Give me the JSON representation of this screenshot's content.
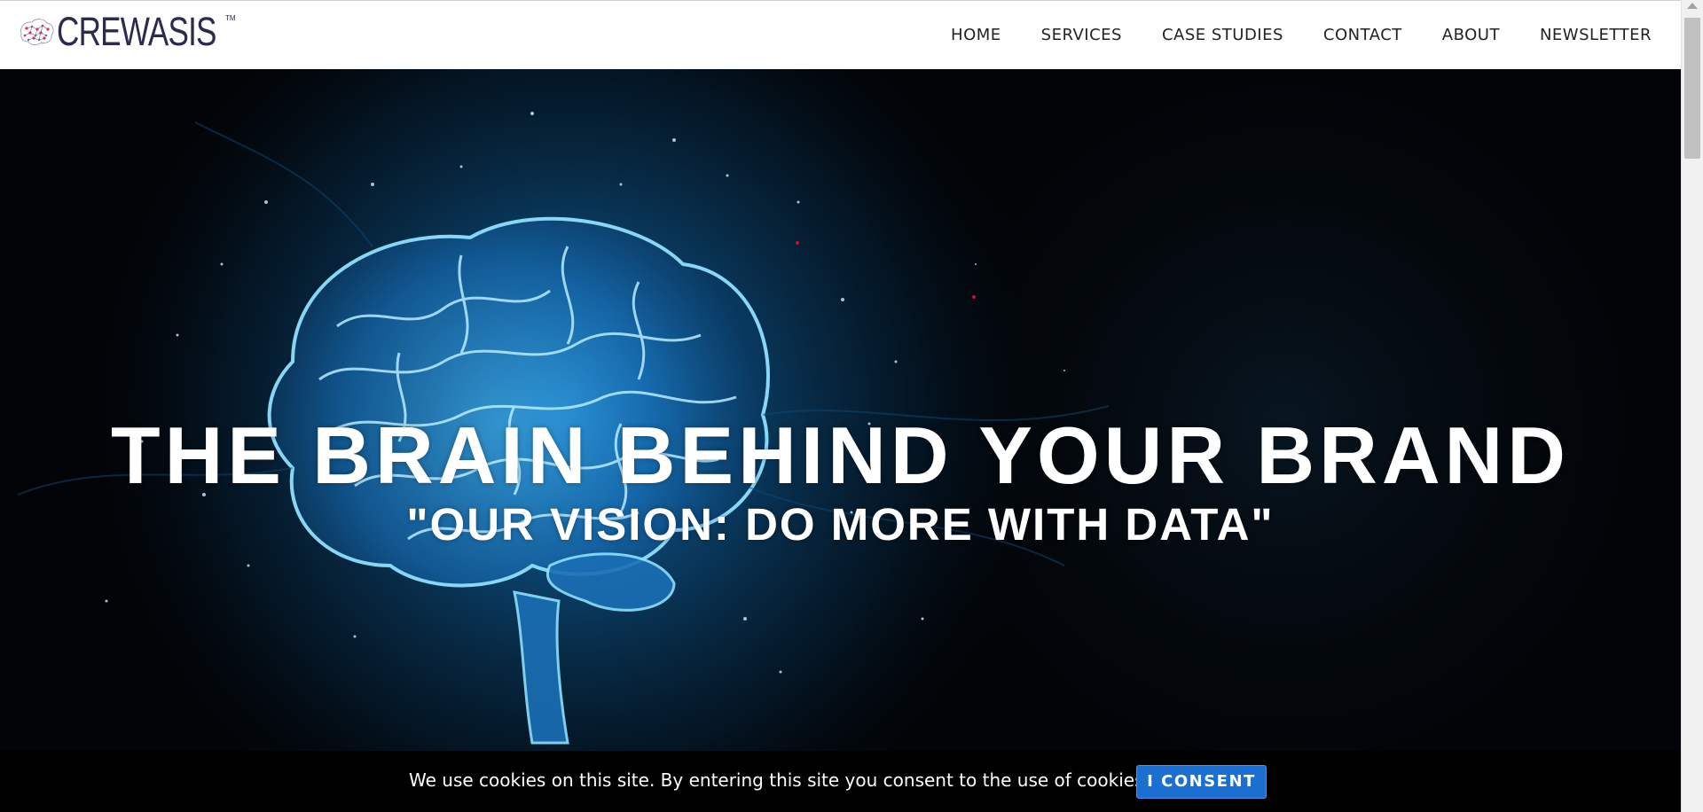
{
  "brand": {
    "name": "CREWASIS",
    "tm": "TM"
  },
  "nav": {
    "items": [
      {
        "label": "HOME"
      },
      {
        "label": "SERVICES"
      },
      {
        "label": "CASE STUDIES"
      },
      {
        "label": "CONTACT"
      },
      {
        "label": "ABOUT"
      },
      {
        "label": "NEWSLETTER"
      }
    ]
  },
  "hero": {
    "title": "THE BRAIN BEHIND YOUR BRAND",
    "subtitle": "\"OUR VISION: DO MORE WITH DATA\""
  },
  "cookie": {
    "message": "We use cookies on this site. By entering this site you consent to the use of cookies.",
    "button_label": "I CONSENT"
  },
  "colors": {
    "brand": "#2b2b4f",
    "consent_button": "#1a6fd0",
    "hero_glow": "#1e8fd8"
  },
  "icons": {
    "logo_mark": "brain-network-icon",
    "hero_image": "glowing-brain-illustration"
  }
}
